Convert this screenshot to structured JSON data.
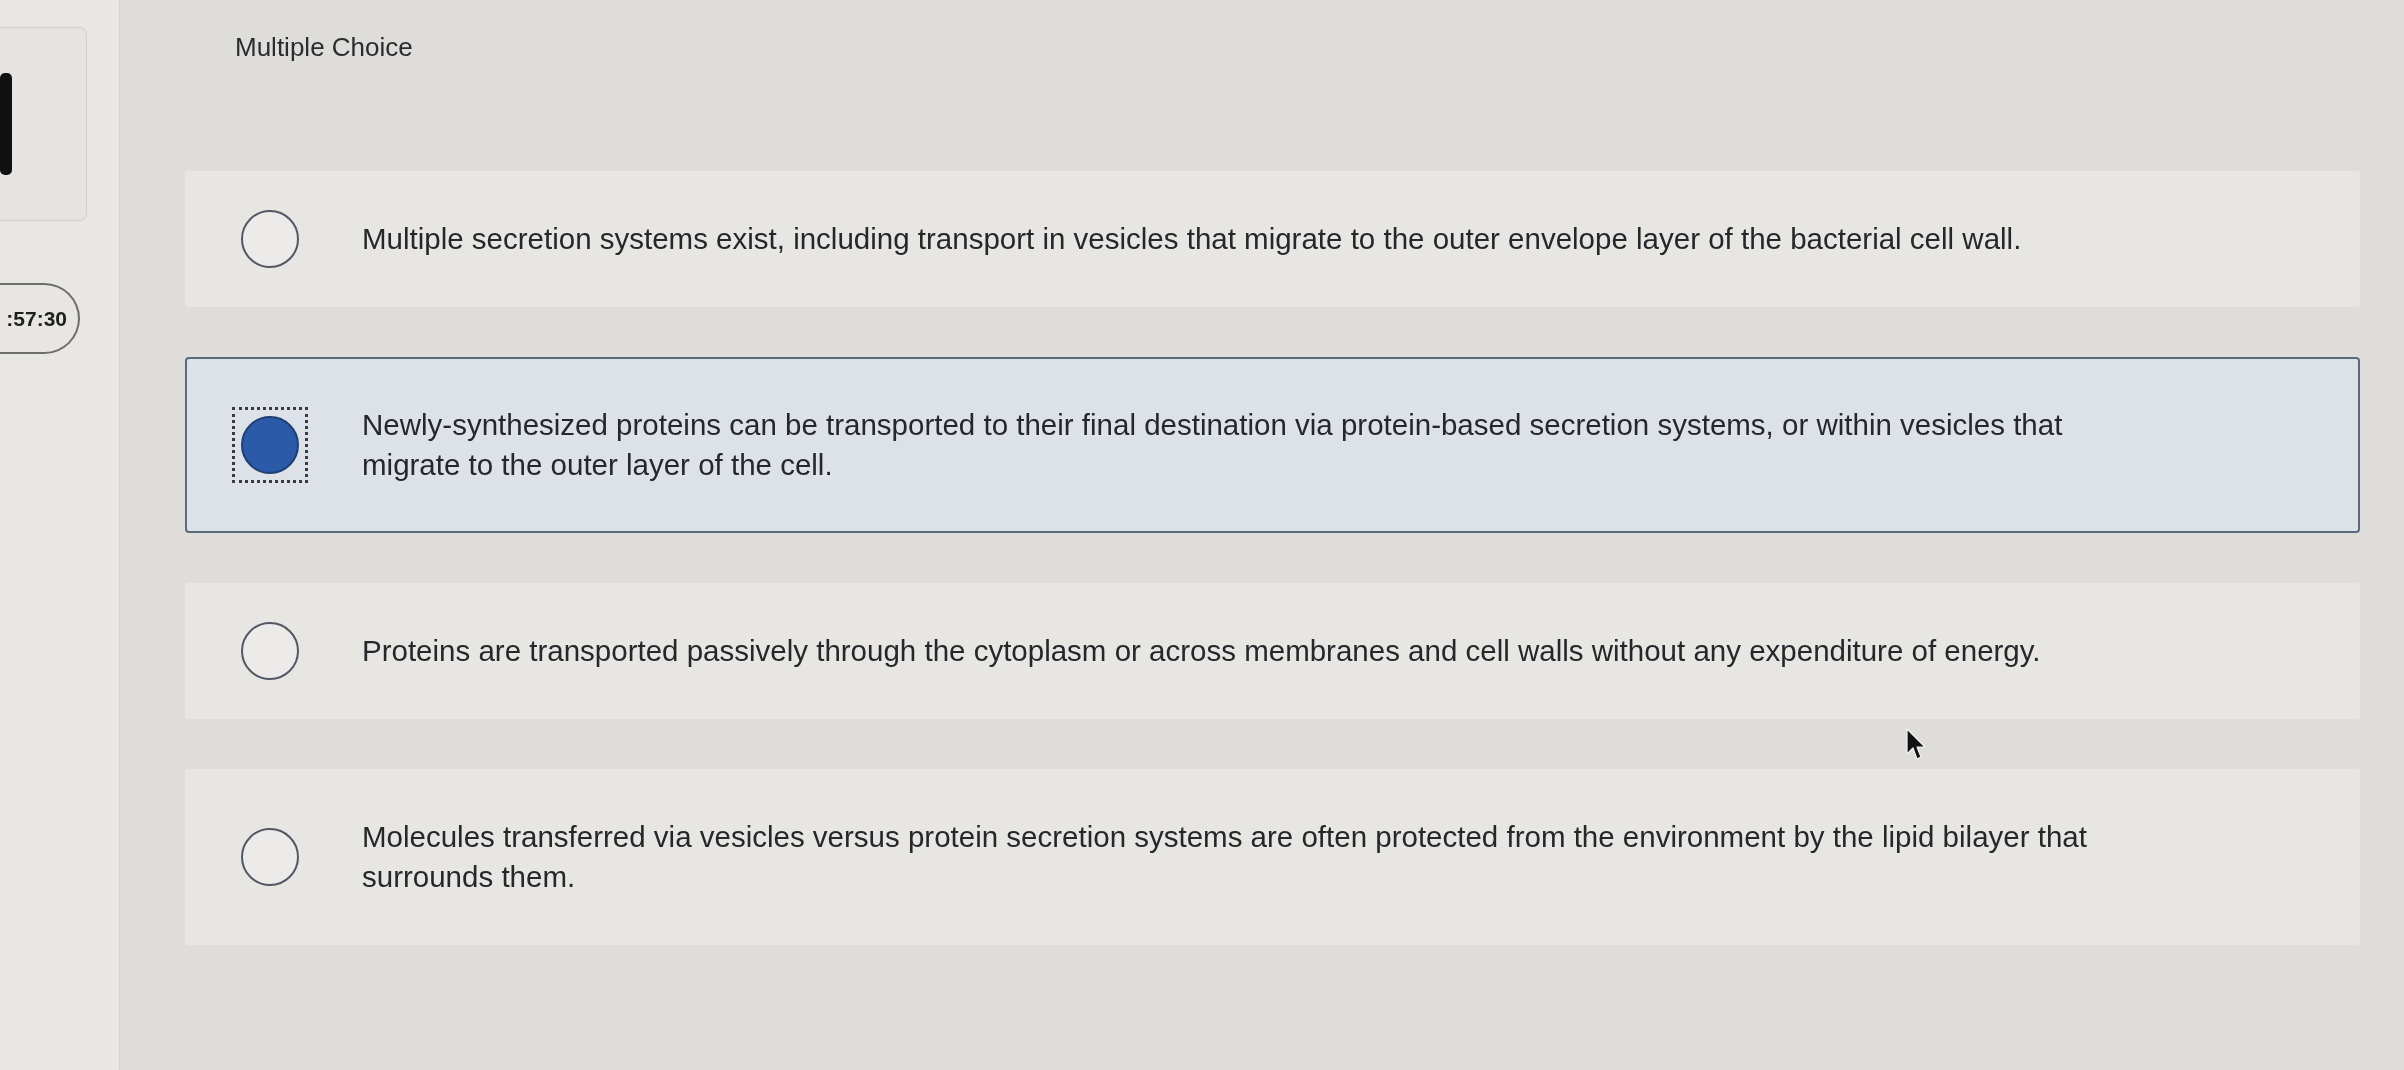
{
  "sidebar": {
    "timer": ":57:30"
  },
  "question": {
    "type_label": "Multiple Choice",
    "options": [
      {
        "text": "Multiple secretion systems exist, including transport in vesicles that migrate to the outer envelope layer of the bacterial cell wall.",
        "selected": false
      },
      {
        "text": "Newly-synthesized proteins can be transported to their final destination via protein-based secretion systems, or within vesicles that migrate to the outer layer of the cell.",
        "selected": true
      },
      {
        "text": "Proteins are transported passively through the cytoplasm or across membranes and cell walls without any expenditure of energy.",
        "selected": false
      },
      {
        "text": "Molecules transferred via vesicles versus protein secretion systems are often protected from the environment by the lipid bilayer that surrounds them.",
        "selected": false
      }
    ]
  }
}
